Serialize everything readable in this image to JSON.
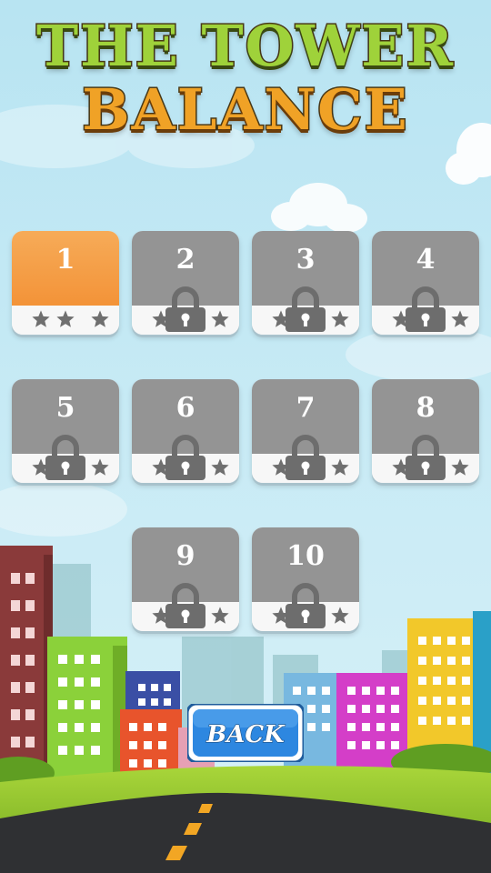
{
  "title": {
    "line1": "THE TOWER",
    "line2": "BALANCE"
  },
  "levels": [
    {
      "number": "1",
      "locked": false,
      "stars_earned": 0,
      "stars_total": 3
    },
    {
      "number": "2",
      "locked": true,
      "stars_earned": 0,
      "stars_total": 3
    },
    {
      "number": "3",
      "locked": true,
      "stars_earned": 0,
      "stars_total": 3
    },
    {
      "number": "4",
      "locked": true,
      "stars_earned": 0,
      "stars_total": 3
    },
    {
      "number": "5",
      "locked": true,
      "stars_earned": 0,
      "stars_total": 3
    },
    {
      "number": "6",
      "locked": true,
      "stars_earned": 0,
      "stars_total": 3
    },
    {
      "number": "7",
      "locked": true,
      "stars_earned": 0,
      "stars_total": 3
    },
    {
      "number": "8",
      "locked": true,
      "stars_earned": 0,
      "stars_total": 3
    },
    {
      "number": "9",
      "locked": true,
      "stars_earned": 0,
      "stars_total": 3
    },
    {
      "number": "10",
      "locked": true,
      "stars_earned": 0,
      "stars_total": 3
    }
  ],
  "back_button": {
    "label": "BACK"
  },
  "colors": {
    "unlocked_tile": "#f39a40",
    "locked_tile": "#949494",
    "star": "#6f6f6f",
    "lock": "#6d6d6d",
    "back_button": "#2d87e0"
  },
  "icons": {
    "lock": "padlock-icon",
    "star": "star-icon"
  }
}
